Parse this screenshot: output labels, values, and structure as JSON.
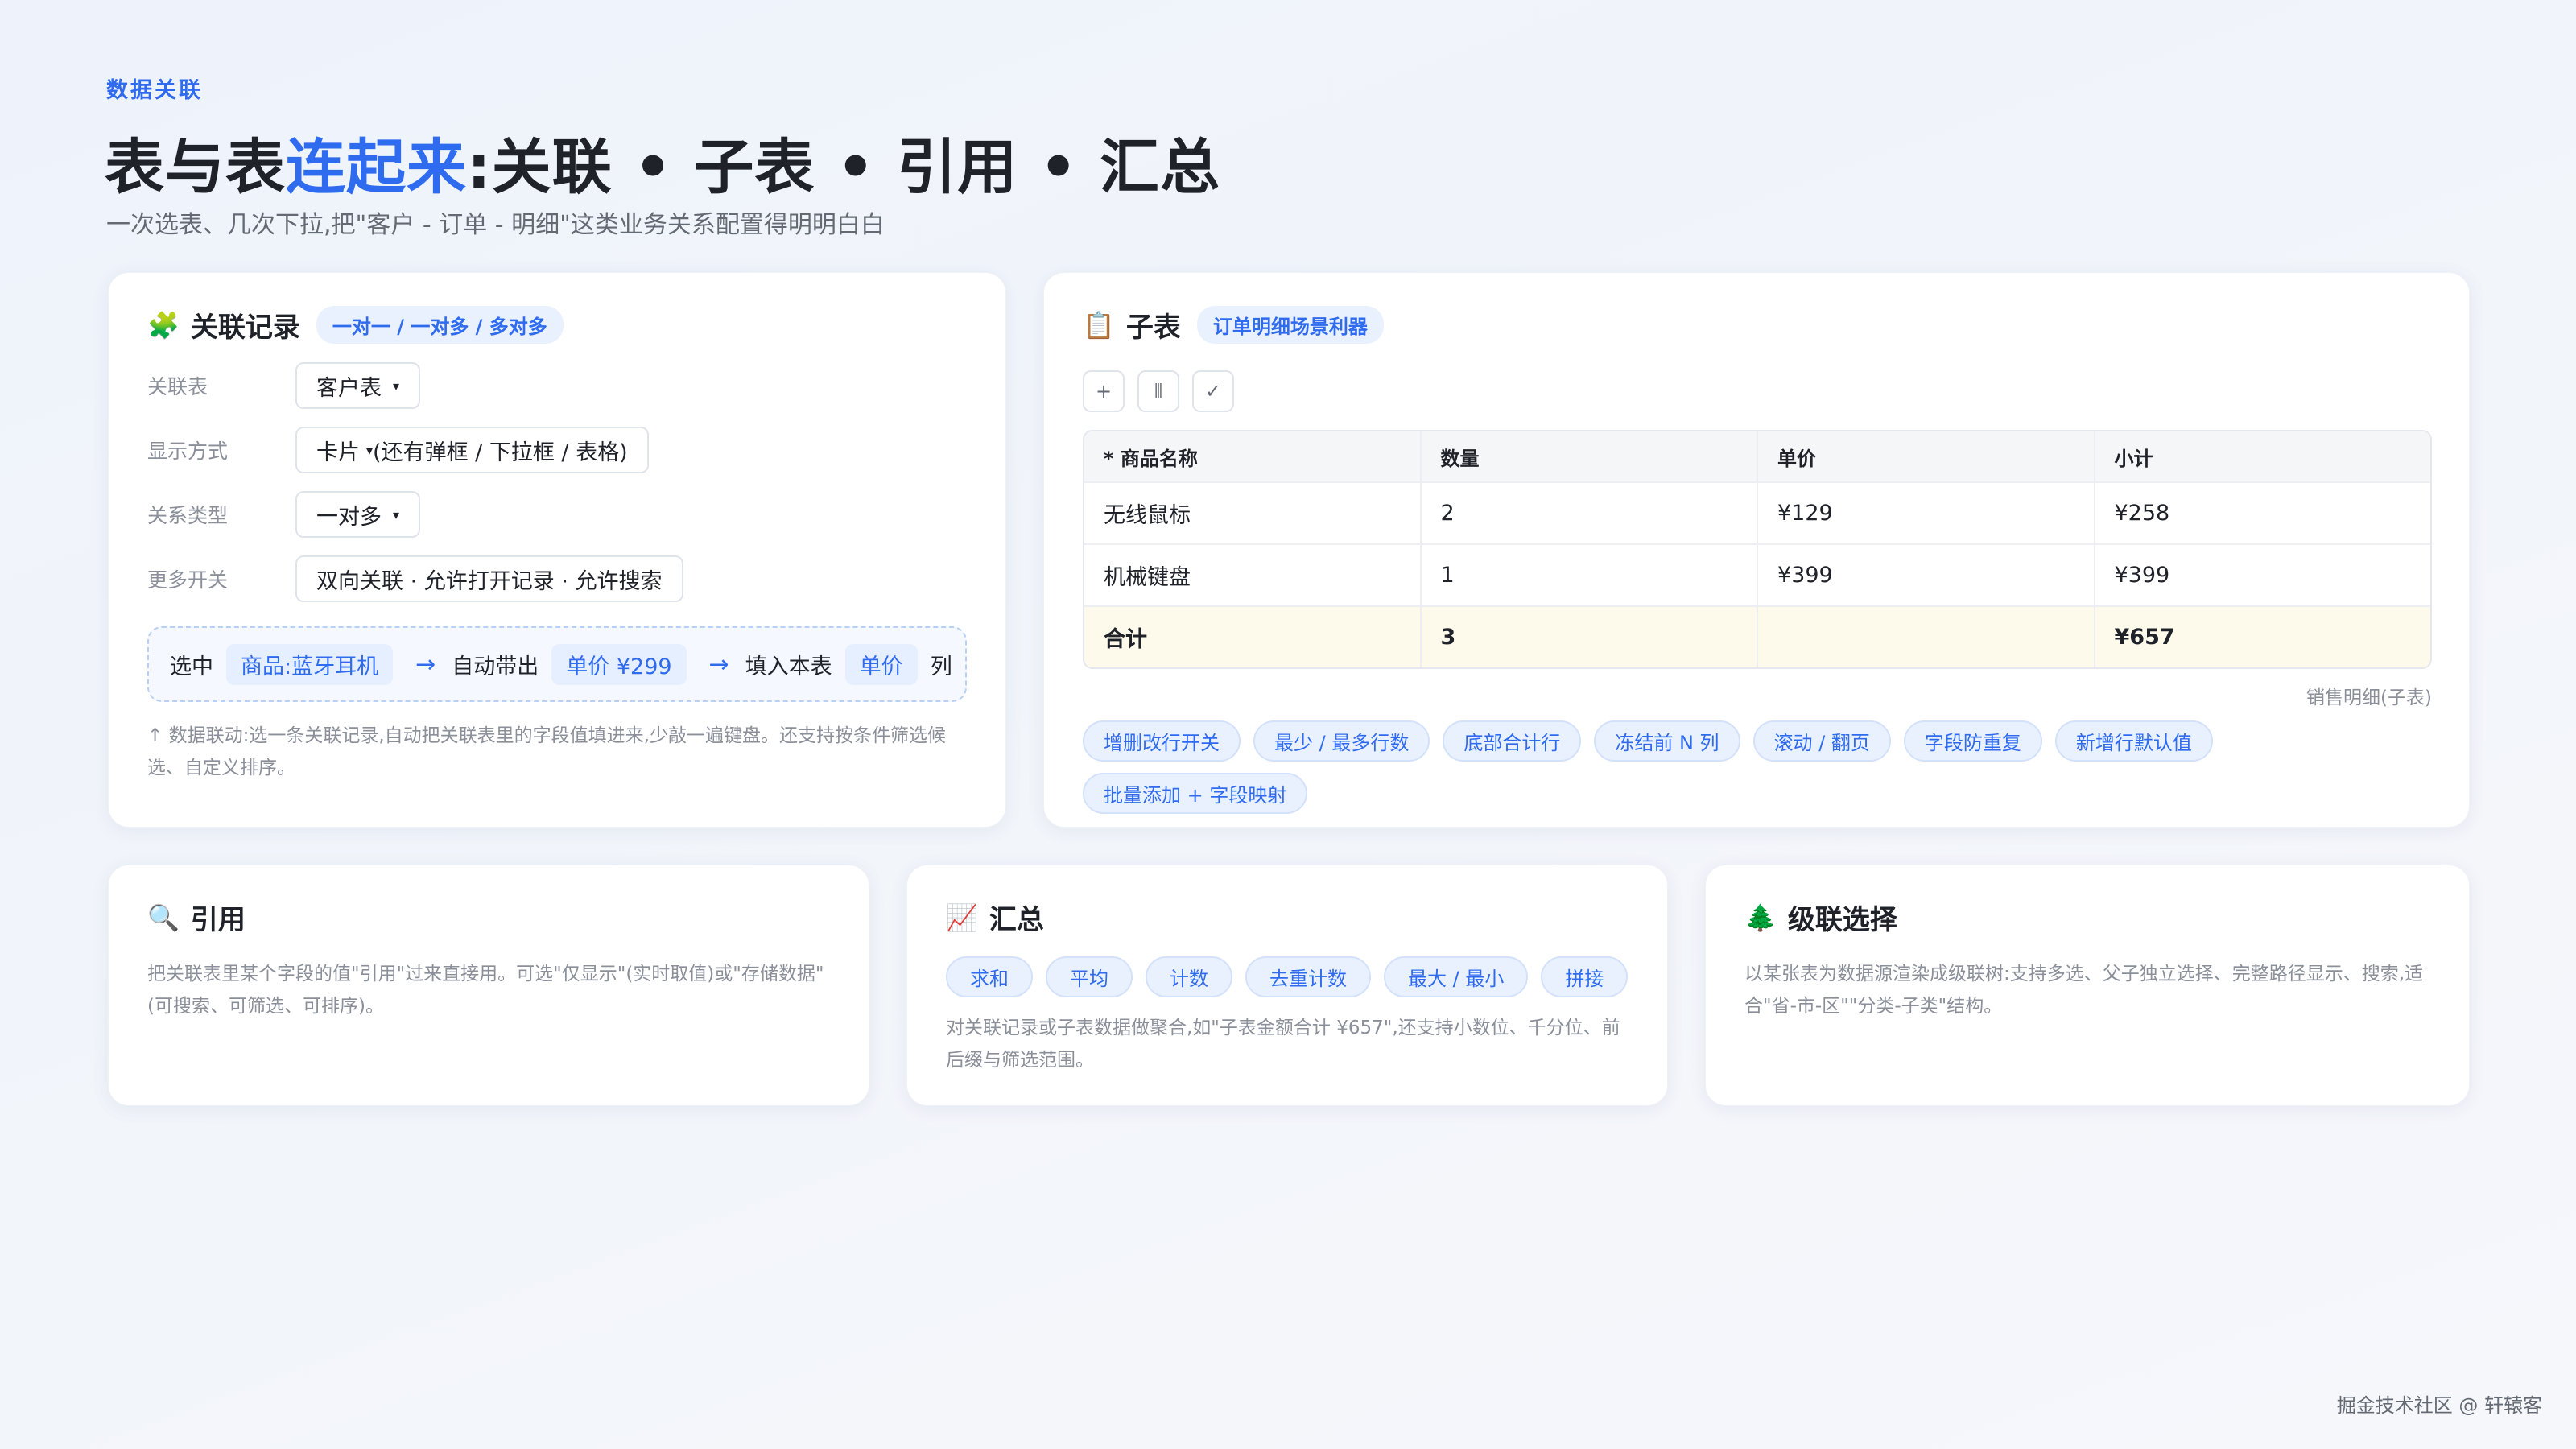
{
  "header": {
    "eyebrow": "数据关联",
    "title_prefix": "表与表",
    "title_highlight": "连起来",
    "title_suffix": ":关联 • 子表 • 引用 • 汇总",
    "subtitle": "一次选表、几次下拉,把\"客户 - 订单 - 明细\"这类业务关系配置得明明白白"
  },
  "relation_card": {
    "icon": "puzzle-icon",
    "icon_glyph": "🧩",
    "title": "关联记录",
    "tag": "一对一 / 一对多 / 多对多",
    "rows": [
      {
        "label": "关联表",
        "value": "客户表",
        "caret": "▾"
      },
      {
        "label": "显示方式",
        "value": "卡片",
        "caret": "▾",
        "extra": "(还有弹框 / 下拉框 / 表格)"
      },
      {
        "label": "关系类型",
        "value": "一对多",
        "caret": "▾"
      },
      {
        "label": "更多开关",
        "value": "双向关联 · 允许打开记录 · 允许搜索"
      }
    ],
    "flow": {
      "select": "选中",
      "chip1": "商品:蓝牙耳机",
      "arrow": "→",
      "auto": "自动带出",
      "chip2": "单价 ¥299",
      "fill": "填入本表",
      "chip3": "单价",
      "column": "列"
    },
    "note": "↑ 数据联动:选一条关联记录,自动把关联表里的字段值填进来,少敲一遍键盘。还支持按条件筛选候选、自定义排序。"
  },
  "subtable_card": {
    "icon": "clipboard-icon",
    "icon_glyph": "📋",
    "title": "子表",
    "tag": "订单明细场景利器",
    "toolbar": [
      "+",
      "⦀",
      "✓"
    ],
    "columns": [
      "* 商品名称",
      "数量",
      "单价",
      "小计"
    ],
    "rows": [
      [
        "无线鼠标",
        "2",
        "¥129",
        "¥258"
      ],
      [
        "机械键盘",
        "1",
        "¥399",
        "¥399"
      ]
    ],
    "total": [
      "合计",
      "3",
      "",
      "¥657"
    ],
    "caption": "销售明细(子表)",
    "features": [
      "增删改行开关",
      "最少 / 最多行数",
      "底部合计行",
      "冻结前 N 列",
      "滚动 / 翻页",
      "字段防重复",
      "新增行默认值",
      "批量添加 + 字段映射"
    ]
  },
  "lookup_card": {
    "icon": "magnifier-icon",
    "icon_glyph": "🔍",
    "title": "引用",
    "desc": "把关联表里某个字段的值\"引用\"过来直接用。可选\"仅显示\"(实时取值)或\"存储数据\"(可搜索、可筛选、可排序)。"
  },
  "rollup_card": {
    "icon": "chart-icon",
    "icon_glyph": "📈",
    "title": "汇总",
    "functions": [
      "求和",
      "平均",
      "计数",
      "去重计数",
      "最大 / 最小",
      "拼接"
    ],
    "desc": "对关联记录或子表数据做聚合,如\"子表金额合计 ¥657\",还支持小数位、千分位、前后缀与筛选范围。"
  },
  "cascade_card": {
    "icon": "tree-icon",
    "icon_glyph": "🌲",
    "title": "级联选择",
    "desc": "以某张表为数据源渲染成级联树:支持多选、父子独立选择、完整路径显示、搜索,适合\"省-市-区\"\"分类-子类\"结构。"
  },
  "footer": "掘金技术社区 @ 轩辕客"
}
